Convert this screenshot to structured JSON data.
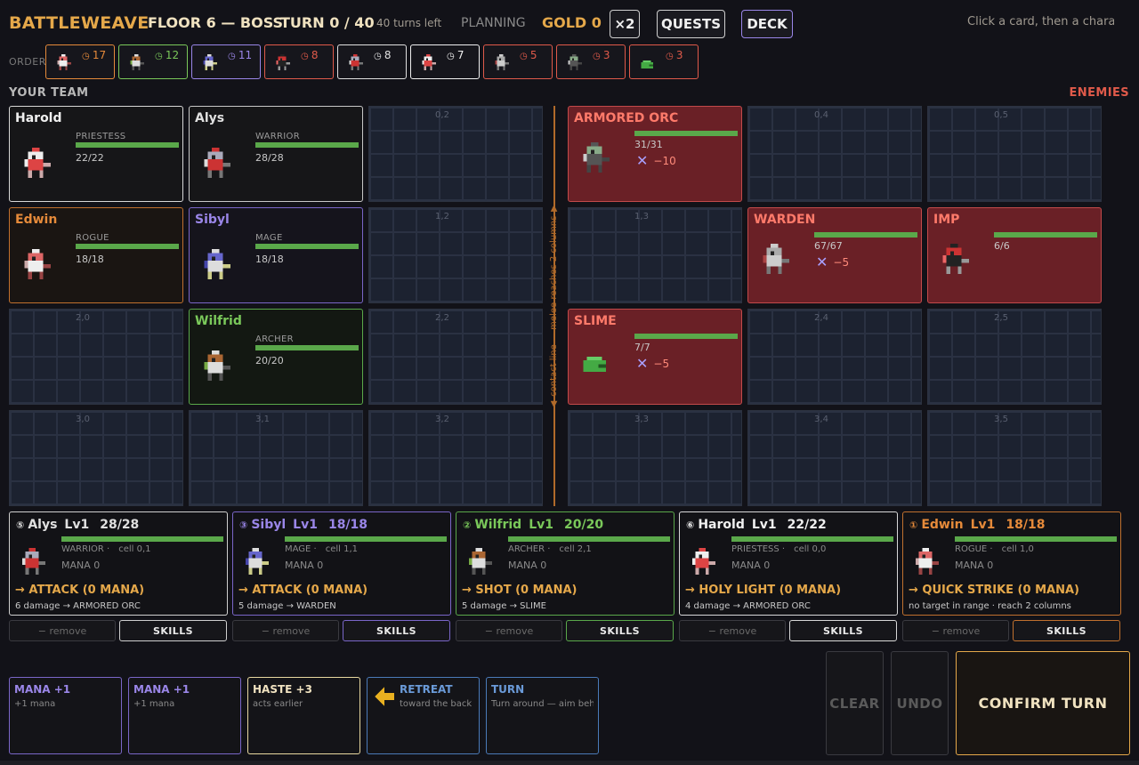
{
  "topbar": {
    "brand": "BATTLEWEAVE",
    "floor": "FLOOR 6 — BOSS",
    "turn": "TURN 0 / 40",
    "turns_left": "40 turns left",
    "phase": "PLANNING",
    "gold": "GOLD 0",
    "speed_label": "×2",
    "quests_label": "QUESTS",
    "deck_label": "DECK",
    "hint": "Click a card, then a charac"
  },
  "order": {
    "label": "ORDER",
    "chips": [
      {
        "unit": "Edwin",
        "num": "17",
        "color": "#e58a3a",
        "icon": "rogue-sprite-icon"
      },
      {
        "unit": "Wilfrid",
        "num": "12",
        "color": "#7ac85a",
        "icon": "archer-sprite-icon"
      },
      {
        "unit": "Sibyl",
        "num": "11",
        "color": "#9a86e8",
        "icon": "mage-sprite-icon"
      },
      {
        "unit": "Imp",
        "num": "8",
        "color": "#e05a4a",
        "icon": "imp-sprite-icon"
      },
      {
        "unit": "Alys",
        "num": "8",
        "color": "#e0e0e0",
        "icon": "warrior-sprite-icon"
      },
      {
        "unit": "Harold",
        "num": "7",
        "color": "#f0f0f0",
        "icon": "priestess-sprite-icon"
      },
      {
        "unit": "Warden",
        "num": "5",
        "color": "#e05a4a",
        "icon": "warden-sprite-icon"
      },
      {
        "unit": "Armored Orc",
        "num": "3",
        "color": "#e05a4a",
        "icon": "orc-sprite-icon"
      },
      {
        "unit": "Slime",
        "num": "3",
        "color": "#e05a4a",
        "icon": "slime-sprite-icon"
      }
    ]
  },
  "board": {
    "team_label": "YOUR TEAM",
    "enemies_label": "ENEMIES",
    "contact_text": "▲ contact line — melee reaches 2 columns ▼",
    "empty_cells": [
      "0,2",
      "0,4",
      "0,5",
      "1,2",
      "1,3",
      "2,0",
      "2,2",
      "2,4",
      "2,5",
      "3,0",
      "3,1",
      "3,2",
      "3,3",
      "3,4",
      "3,5"
    ],
    "allies": [
      {
        "name": "Harold",
        "role": "PRIESTESS",
        "hp": "22/22",
        "color": "#f0f0f0",
        "border": "#d8d8d8",
        "bg": "#161618",
        "icon": "priestess-sprite-icon"
      },
      {
        "name": "Alys",
        "role": "WARRIOR",
        "hp": "28/28",
        "color": "#e0e0e0",
        "border": "#c8c8c8",
        "bg": "#161618",
        "icon": "warrior-sprite-icon"
      },
      {
        "name": "Edwin",
        "role": "ROGUE",
        "hp": "18/18",
        "color": "#e58a3a",
        "border": "#c0702e",
        "bg": "#1a1512",
        "icon": "rogue-sprite-icon"
      },
      {
        "name": "Sibyl",
        "role": "MAGE",
        "hp": "18/18",
        "color": "#9a86e8",
        "border": "#7a66c8",
        "bg": "#15141c",
        "icon": "mage-sprite-icon"
      },
      {
        "name": "Wilfrid",
        "role": "ARCHER",
        "hp": "20/20",
        "color": "#7ac85a",
        "border": "#5aa84a",
        "bg": "#131812",
        "icon": "archer-sprite-icon"
      }
    ],
    "enemies": [
      {
        "name": "ARMORED ORC",
        "hp": "31/31",
        "intent": "−10",
        "icon": "orc-sprite-icon"
      },
      {
        "name": "WARDEN",
        "hp": "67/67",
        "intent": "−5",
        "icon": "warden-sprite-icon"
      },
      {
        "name": "IMP",
        "hp": "6/6",
        "intent": "",
        "icon": "imp-sprite-icon"
      },
      {
        "name": "SLIME",
        "hp": "7/7",
        "intent": "−5",
        "icon": "slime-sprite-icon"
      }
    ]
  },
  "heroes": [
    {
      "order": "⑤",
      "name": "Alys",
      "lv": "Lv1",
      "hp": "28/28",
      "role": "WARRIOR ·",
      "cell": "cell 0,1",
      "mana": "MANA 0",
      "action": "→ ATTACK  (0 MANA)",
      "detail": "6 damage → ARMORED ORC",
      "color": "#e0e0e0",
      "border": "#cfcfcf",
      "remove": "− remove",
      "skills": "SKILLS",
      "icon": "warrior-sprite-icon"
    },
    {
      "order": "③",
      "name": "Sibyl",
      "lv": "Lv1",
      "hp": "18/18",
      "role": "MAGE ·",
      "cell": "cell 1,1",
      "mana": "MANA 0",
      "action": "→ ATTACK  (0 MANA)",
      "detail": "5 damage → WARDEN",
      "color": "#9a86e8",
      "border": "#7a66c8",
      "remove": "− remove",
      "skills": "SKILLS",
      "icon": "mage-sprite-icon"
    },
    {
      "order": "②",
      "name": "Wilfrid",
      "lv": "Lv1",
      "hp": "20/20",
      "role": "ARCHER ·",
      "cell": "cell 2,1",
      "mana": "MANA 0",
      "action": "→ SHOT  (0 MANA)",
      "detail": "5 damage → SLIME",
      "color": "#7ac85a",
      "border": "#5aa84a",
      "remove": "− remove",
      "skills": "SKILLS",
      "icon": "archer-sprite-icon"
    },
    {
      "order": "⑥",
      "name": "Harold",
      "lv": "Lv1",
      "hp": "22/22",
      "role": "PRIESTESS ·",
      "cell": "cell 0,0",
      "mana": "MANA 0",
      "action": "→ HOLY LIGHT  (0 MANA)",
      "detail": "4 damage → ARMORED ORC",
      "color": "#f0f0f0",
      "border": "#d8d8d8",
      "remove": "− remove",
      "skills": "SKILLS",
      "icon": "priestess-sprite-icon"
    },
    {
      "order": "①",
      "name": "Edwin",
      "lv": "Lv1",
      "hp": "18/18",
      "role": "ROGUE ·",
      "cell": "cell 1,0",
      "mana": "MANA 0",
      "action": "→ QUICK STRIKE  (0 MANA)",
      "detail": "no target in range · reach 2 columns",
      "color": "#e58a3a",
      "border": "#c0702e",
      "remove": "− remove",
      "skills": "SKILLS",
      "icon": "rogue-sprite-icon"
    }
  ],
  "hand": [
    {
      "title": "MANA +1",
      "desc": "+1 mana",
      "color": "#9a86e8",
      "border": "#7a66c8"
    },
    {
      "title": "MANA +1",
      "desc": "+1 mana",
      "color": "#9a86e8",
      "border": "#7a66c8"
    },
    {
      "title": "HASTE +3",
      "desc": "acts earlier",
      "color": "#f0e2c0",
      "border": "#e8d8a0"
    },
    {
      "title": "RETREAT",
      "desc": "toward the back",
      "color": "#6a9ad8",
      "border": "#4a7ab8",
      "icon": "arrow-left-icon"
    },
    {
      "title": "TURN",
      "desc": "Turn around — aim behi",
      "color": "#6a9ad8",
      "border": "#4a7ab8"
    }
  ],
  "actions": {
    "clear": "CLEAR",
    "undo": "UNDO",
    "confirm": "CONFIRM TURN"
  }
}
